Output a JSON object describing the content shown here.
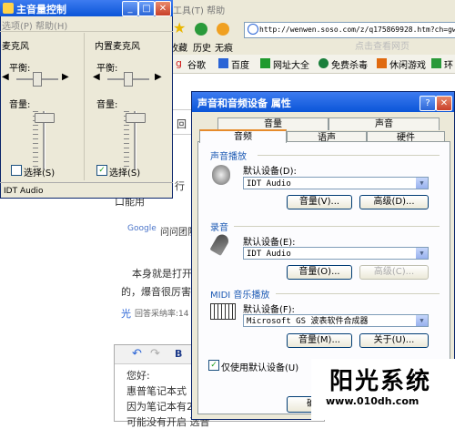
{
  "browser": {
    "menu": "工具(T)  帮助",
    "toolbar": {
      "favorites": "收藏",
      "history": "历史",
      "none": "无痕"
    },
    "address": "http://wenwen.soso.com/z/q175869928.htm?ch=gw",
    "address_ghost": "点击查看网页",
    "links": [
      "谷歌",
      "百度",
      "网址大全",
      "免费杀毒",
      "休闲游戏",
      "环"
    ],
    "page": {
      "line_partial_1": "回",
      "line_partial_2": "行",
      "line_partial_3": "口能用",
      "google_logo": "Google",
      "question_team": "问问团队",
      "answer_line_1": "本身就是打开",
      "answer_line_2": "的，爆音很厉害",
      "answer_rate": "回答采纳率:14",
      "editor_lines": [
        "您好:",
        "惠普笔记本式",
        "因为笔记本有2",
        "可能没有开启 选音"
      ]
    }
  },
  "volume_control": {
    "title": "主音量控制",
    "menu": "选项(P)  帮助(H)",
    "columns": [
      {
        "label": "麦克风",
        "balance": "平衡:",
        "volume": "音量:",
        "select": "选择(S)",
        "checked": false
      },
      {
        "label": "内置麦克风",
        "balance": "平衡:",
        "volume": "音量:",
        "select": "选择(S)",
        "checked": true
      }
    ],
    "status": "IDT Audio"
  },
  "dialog": {
    "title": "声音和音频设备 属性",
    "help_btn": "?",
    "close_btn": "✕",
    "tabs_back": [
      "音量",
      "声音"
    ],
    "tabs_front": [
      "音频",
      "语声",
      "硬件"
    ],
    "playback": {
      "group": "声音播放",
      "default_label": "默认设备(D):",
      "device": "IDT Audio",
      "volume_btn": "音量(V)...",
      "advanced_btn": "高级(D)..."
    },
    "recording": {
      "group": "录音",
      "default_label": "默认设备(E):",
      "device": "IDT Audio",
      "volume_btn": "音量(O)...",
      "advanced_btn": "高级(C)..."
    },
    "midi": {
      "group": "MIDI 音乐播放",
      "default_label": "默认设备(F):",
      "device": "Microsoft GS 波表软件合成器",
      "volume_btn": "音量(M)...",
      "about_btn": "关于(U)..."
    },
    "use_default": "仅使用默认设备(U)",
    "use_default_checked": true,
    "ok_btn": "确定"
  },
  "watermark": {
    "title": "阳光系统",
    "url": "www.010dh.com"
  },
  "colors": {
    "titlebar": "#0a55d8",
    "dialog_bg": "#ece9d8",
    "group_title": "#1d5ab4"
  }
}
